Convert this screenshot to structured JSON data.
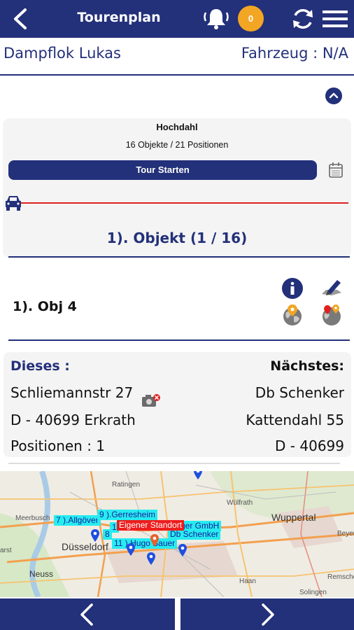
{
  "header": {
    "title": "Tourenplan",
    "badge_count": "0"
  },
  "driver_name": "Dampflok Lukas",
  "vehicle_label": "Fahrzeug : N/A",
  "tour": {
    "place": "Hochdahl",
    "counts": "16 Objekte / 21 Positionen",
    "start_button": "Tour Starten",
    "object_heading": "1). Objekt  (1 / 16)",
    "progress": 0
  },
  "object": {
    "name": "1). Obj 4"
  },
  "details": {
    "this_label": "Dieses :",
    "next_label": "Nächstes:",
    "this_street": "Schliemannstr 27",
    "this_city": "D - 40699 Erkrath",
    "this_positions": "Positionen : 1",
    "next_name": "Db Schenker",
    "next_street": "Kattendahl 55",
    "next_city": "D - 40699"
  },
  "map": {
    "places": {
      "ratingen": "Ratingen",
      "wulfrath": "Wülfrath",
      "wuppertal": "Wuppertal",
      "meerbusch": "Meerbusch",
      "dusseldorf": "Düsseldorf",
      "neuss": "Neuss",
      "haan": "Haan",
      "remscheid": "Remscheid",
      "solingen": "Solingen",
      "beyer": "Beyer",
      "kaarst": "arst"
    },
    "tags": {
      "t7": "7 ).Allgöver",
      "t9": "9 ).Gerresheim",
      "own": "Eigener Standort",
      "gmbh": "ger  GmbH",
      "schenker": "Db Schenker",
      "t11": "11 ).Hugo Bauer",
      "t1": "1",
      "t8": "8"
    },
    "colors": {
      "tag": "#26ecf0",
      "own_location": "#ee1d1d",
      "pin": "#1f4fe0"
    }
  }
}
